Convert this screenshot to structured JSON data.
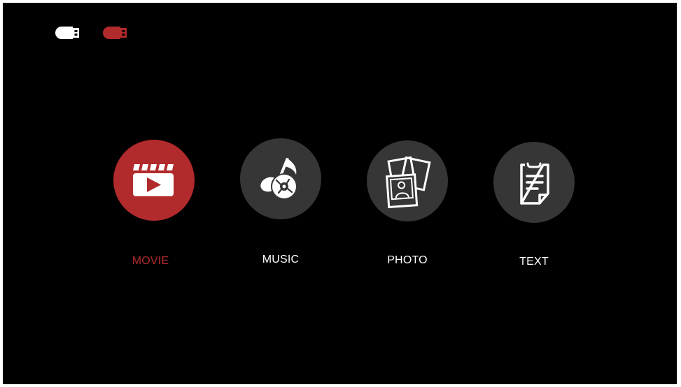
{
  "colors": {
    "background": "#000000",
    "accent": "#b12a2c",
    "tile_inactive": "#363636",
    "label_inactive": "#ffffff"
  },
  "usb_devices": [
    {
      "icon": "usb-drive-icon",
      "color": "#ffffff",
      "selected": false
    },
    {
      "icon": "usb-drive-icon",
      "color": "#b12a2c",
      "selected": true
    }
  ],
  "menu": {
    "selected": "movie",
    "items": [
      {
        "id": "movie",
        "label": "MOVIE",
        "icon": "clapperboard-play-icon"
      },
      {
        "id": "music",
        "label": "MUSIC",
        "icon": "music-note-disc-icon"
      },
      {
        "id": "photo",
        "label": "PHOTO",
        "icon": "photos-icon"
      },
      {
        "id": "text",
        "label": "TEXT",
        "icon": "document-icon"
      }
    ]
  }
}
